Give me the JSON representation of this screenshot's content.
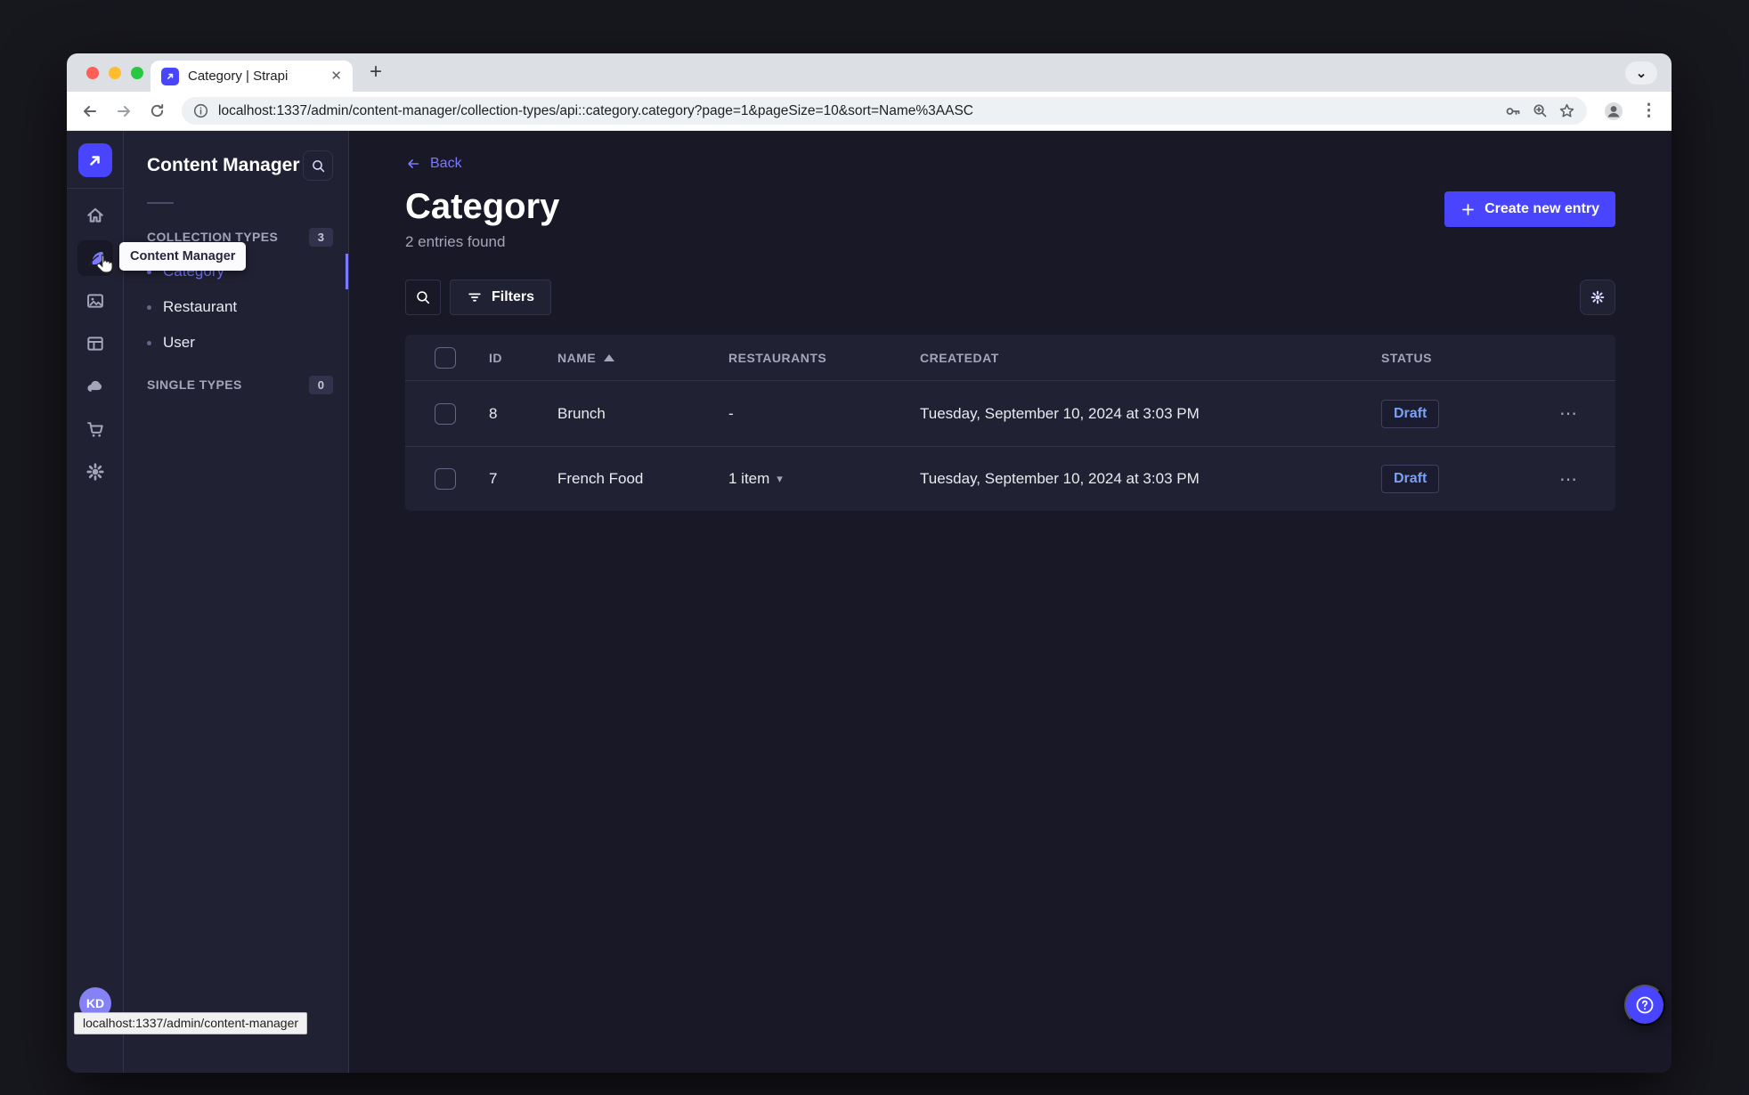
{
  "browser": {
    "tab_title": "Category | Strapi",
    "url": "localhost:1337/admin/content-manager/collection-types/api::category.category?page=1&pageSize=10&sort=Name%3AASC",
    "link_preview": "localhost:1337/admin/content-manager"
  },
  "icons": {
    "close": "✕",
    "new_tab": "+",
    "tab_search_chevron": "⌄",
    "browser_menu": "⋮",
    "row_menu": "⋯",
    "caret_down": "▾"
  },
  "mainnav": {
    "tooltip": "Content Manager",
    "avatar_initials": "KD"
  },
  "subnav": {
    "title": "Content Manager",
    "collection_types": {
      "label": "COLLECTION TYPES",
      "count": "3",
      "items": [
        {
          "label": "Category"
        },
        {
          "label": "Restaurant"
        },
        {
          "label": "User"
        }
      ]
    },
    "single_types": {
      "label": "SINGLE TYPES",
      "count": "0"
    }
  },
  "page": {
    "back": "Back",
    "title": "Category",
    "subtitle": "2 entries found",
    "create_button": "Create new entry",
    "filters_button": "Filters"
  },
  "table": {
    "columns": {
      "id": "ID",
      "name": "NAME",
      "restaurants": "RESTAURANTS",
      "createdat": "CREATEDAT",
      "status": "STATUS"
    },
    "rows": [
      {
        "id": "8",
        "name": "Brunch",
        "restaurants": "-",
        "createdat": "Tuesday, September 10, 2024 at 3:03 PM",
        "status": "Draft"
      },
      {
        "id": "7",
        "name": "French Food",
        "restaurants": "1 item",
        "createdat": "Tuesday, September 10, 2024 at 3:03 PM",
        "status": "Draft"
      }
    ]
  },
  "colors": {
    "primary": "#4945ff",
    "primary_light": "#7b79ff",
    "draft_text": "#7ba0f5",
    "panel": "#212134",
    "background": "#181826"
  }
}
